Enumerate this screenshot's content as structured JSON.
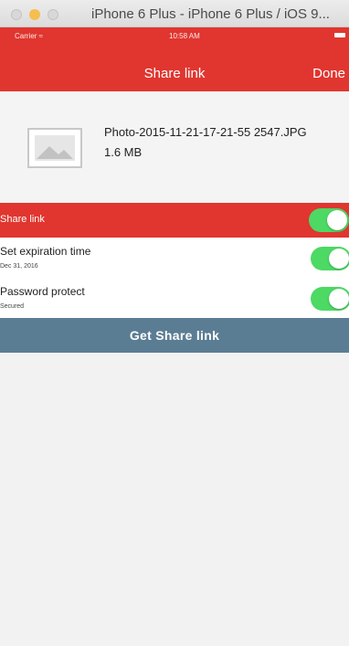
{
  "window": {
    "title": "iPhone 6 Plus - iPhone 6 Plus / iOS 9..."
  },
  "status_bar": {
    "carrier": "Carrier ≈",
    "time": "10:58 AM"
  },
  "nav": {
    "title": "Share link",
    "done_label": "Done"
  },
  "file": {
    "name": "Photo-2015-11-21-17-21-55 2547.JPG",
    "size": "1.6 MB"
  },
  "share_link": {
    "label": "Share link",
    "enabled": true
  },
  "options": [
    {
      "title": "Set expiration time",
      "subtitle": "Dec 31, 2016",
      "enabled": true
    },
    {
      "title": "Password protect",
      "subtitle": "Secured",
      "enabled": true
    }
  ],
  "button": {
    "label": "Get Share link"
  },
  "colors": {
    "brand_red": "#e0362f",
    "toggle_on": "#4cd964",
    "button": "#5b7d93"
  },
  "icons": [
    "photo-placeholder-icon",
    "battery-icon"
  ]
}
